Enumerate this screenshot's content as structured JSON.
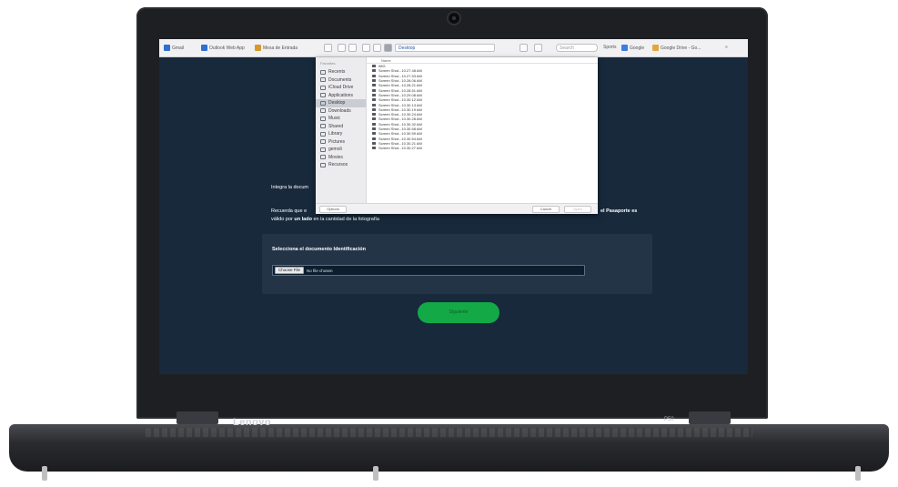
{
  "laptop": {
    "brand": "Lenovo",
    "model": "P50"
  },
  "browser_toolbar": {
    "bookmarks": [
      "Gmail",
      "Outlook Web App",
      "Mesa de Entrada"
    ],
    "folder": "Desktop",
    "search_placeholder": "Search",
    "right_bookmarks": [
      "Sports",
      "Google",
      "Google Drive - Go...",
      "»"
    ]
  },
  "file_dialog": {
    "favorites_label": "Favorites",
    "sidebar": [
      {
        "label": "Recents",
        "icon": "clock-icon"
      },
      {
        "label": "Documents",
        "icon": "document-icon"
      },
      {
        "label": "iCloud Drive",
        "icon": "cloud-icon"
      },
      {
        "label": "Applications",
        "icon": "applications-icon"
      },
      {
        "label": "Desktop",
        "icon": "desktop-icon",
        "active": true
      },
      {
        "label": "Downloads",
        "icon": "download-icon"
      },
      {
        "label": "Music",
        "icon": "music-icon"
      },
      {
        "label": "Shared",
        "icon": "folder-icon"
      },
      {
        "label": "Library",
        "icon": "folder-icon"
      },
      {
        "label": "Pictures",
        "icon": "pictures-icon"
      },
      {
        "label": "gemoli",
        "icon": "home-icon"
      },
      {
        "label": "Movies",
        "icon": "movies-icon"
      },
      {
        "label": "Recursos",
        "icon": "folder-icon"
      }
    ],
    "column_header": "Name",
    "files": [
      "IMG",
      "Screen Shot...10.27.48 AM",
      "Screen Shot...10.27.53 AM",
      "Screen Shot...10.28.06 AM",
      "Screen Shot...10.28.21 AM",
      "Screen Shot...10.28.51 AM",
      "Screen Shot...10.29.08 AM",
      "Screen Shot...10.30.12 AM",
      "Screen Shot...10.30.13 AM",
      "Screen Shot...10.30.19 AM",
      "Screen Shot...10.30.24 AM",
      "Screen Shot...10.30.28 AM",
      "Screen Shot...10.30.32 AM",
      "Screen Shot...10.30.58 AM",
      "Screen Shot...10.30.59 AM",
      "Screen Shot...10.30.54 AM",
      "Screen Shot...10.30.21 AM",
      "Screen Shot...10.30.27 AM"
    ],
    "options_label": "Options",
    "cancel_label": "Cancel",
    "open_label": "Open"
  },
  "page": {
    "intro_text": "Integra la docum",
    "note_prefix": "Recuerda que e",
    "note_highlight_right": "el Pasaporte es",
    "note_line2_prefix": "válido por ",
    "note_line2_bold": "un lado",
    "note_line2_suffix": " en la cantidad de la fotografía",
    "card_title": "Selecciona el documento Identificación",
    "choose_file_label": "Choose File",
    "no_file_label": "No file chosen",
    "submit_label": "Siguiente"
  }
}
